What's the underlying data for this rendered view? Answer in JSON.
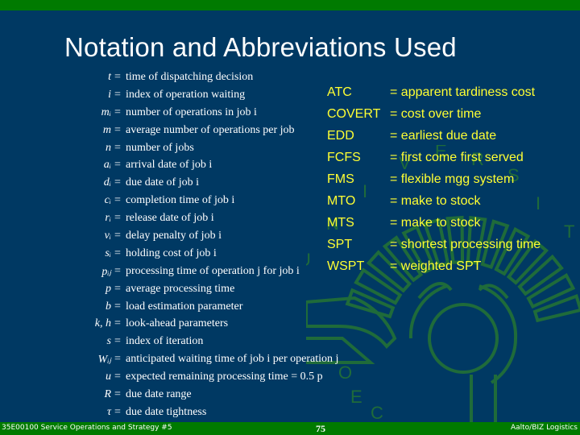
{
  "slide": {
    "title": "Notation and Abbreviations Used",
    "colors": {
      "background": "#003963",
      "bar": "#007a00",
      "abbreviation_text": "#ffff33",
      "emblem": "#1f6b3a"
    }
  },
  "notation": [
    {
      "symbol": "t",
      "relation": "=",
      "definition": "time of dispatching decision"
    },
    {
      "symbol": "i",
      "relation": "=",
      "definition": "index of operation waiting"
    },
    {
      "symbol": "mᵢ",
      "relation": "=",
      "definition": "number of operations in job i"
    },
    {
      "symbol": "m",
      "relation": "=",
      "definition": "average number of operations per job"
    },
    {
      "symbol": "n",
      "relation": "=",
      "definition": "number of jobs"
    },
    {
      "symbol": "aᵢ",
      "relation": "=",
      "definition": "arrival date of job i"
    },
    {
      "symbol": "dᵢ",
      "relation": "=",
      "definition": "due date of job i"
    },
    {
      "symbol": "cᵢ",
      "relation": "=",
      "definition": "completion time of job i"
    },
    {
      "symbol": "rᵢ",
      "relation": "=",
      "definition": "release date of job i"
    },
    {
      "symbol": "vᵢ",
      "relation": "=",
      "definition": "delay penalty of job i"
    },
    {
      "symbol": "sᵢ",
      "relation": "=",
      "definition": "holding cost of job i"
    },
    {
      "symbol": "pᵢⱼ",
      "relation": "=",
      "definition": "processing time of operation j for job i"
    },
    {
      "symbol": "p",
      "relation": "=",
      "definition": "average processing time"
    },
    {
      "symbol": "b",
      "relation": "=",
      "definition": "load estimation parameter"
    },
    {
      "symbol": "k, h",
      "relation": "=",
      "definition": "look-ahead parameters"
    },
    {
      "symbol": "s",
      "relation": "=",
      "definition": "index of iteration"
    },
    {
      "symbol": "Wᵢⱼ",
      "relation": "=",
      "definition": "anticipated waiting time of job i per operation j"
    },
    {
      "symbol": "u",
      "relation": "=",
      "definition": "expected remaining processing time = 0.5 p"
    },
    {
      "symbol": "R",
      "relation": "=",
      "definition": "due date range"
    },
    {
      "symbol": "τ",
      "relation": "=",
      "definition": "due date tightness"
    }
  ],
  "abbreviations": [
    {
      "code": "ATC",
      "meaning": "= apparent tardiness cost"
    },
    {
      "code": "COVERT",
      "meaning": "= cost over time"
    },
    {
      "code": "EDD",
      "meaning": "= earliest due date"
    },
    {
      "code": "FCFS",
      "meaning": "= first come first served"
    },
    {
      "code": "FMS",
      "meaning": "= flexible mgg system"
    },
    {
      "code": "MTO",
      "meaning": "= make to stock"
    },
    {
      "code": "MTS",
      "meaning": "= make to stock"
    },
    {
      "code": "SPT",
      "meaning": "= shortest processing time"
    },
    {
      "code": "WSPT",
      "meaning": "= weighted SPT"
    }
  ],
  "emblem": {
    "icon": "university-seal-icon",
    "letters": [
      "U",
      "N",
      "I",
      "V",
      "E",
      "R",
      "S",
      "I",
      "T",
      "O",
      "E",
      "C"
    ]
  },
  "footer": {
    "course": "35E00100 Service Operations and Strategy #5",
    "page_number": "75",
    "organization": "Aalto/BIZ Logistics"
  }
}
